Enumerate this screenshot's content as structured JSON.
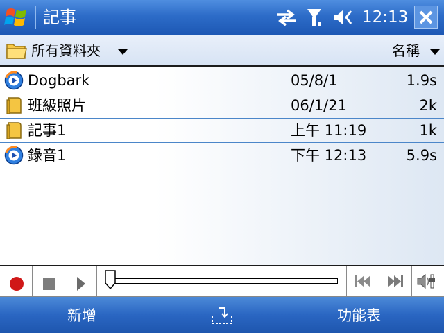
{
  "titlebar": {
    "start_icon": "windows-flag-icon",
    "title": "記事",
    "status_icons": [
      "sync-arrows-icon",
      "signal-antenna-icon",
      "speaker-muted-icon"
    ],
    "time": "12:13",
    "close_icon": "close-icon"
  },
  "folderbar": {
    "folder_icon": "folder-icon",
    "folder_label": "所有資料夾",
    "sort_label": "名稱"
  },
  "files": [
    {
      "icon": "media-file-icon",
      "name": "Dogbark",
      "date": "05/8/1",
      "size": "1.9s",
      "selected": false
    },
    {
      "icon": "note-file-icon",
      "name": "班級照片",
      "date": "06/1/21",
      "size": "2k",
      "selected": false
    },
    {
      "icon": "note-file-icon",
      "name": "記事1",
      "date": "上午 11:19",
      "size": "1k",
      "selected": true
    },
    {
      "icon": "media-file-icon",
      "name": "錄音1",
      "date": "下午 12:13",
      "size": "5.9s",
      "selected": false
    }
  ],
  "player": {
    "record_icon": "record-icon",
    "stop_icon": "stop-icon",
    "play_icon": "play-icon",
    "progress": 0,
    "prev_icon": "skip-back-icon",
    "next_icon": "skip-forward-icon",
    "volume_icon": "volume-icon"
  },
  "menubar": {
    "left_softkey": "新增",
    "sip_icon": "input-panel-icon",
    "right_softkey": "功能表"
  },
  "colors": {
    "titlebar": "#2d6cc8",
    "selection_border": "#4b86c9",
    "record_red": "#d01818"
  }
}
